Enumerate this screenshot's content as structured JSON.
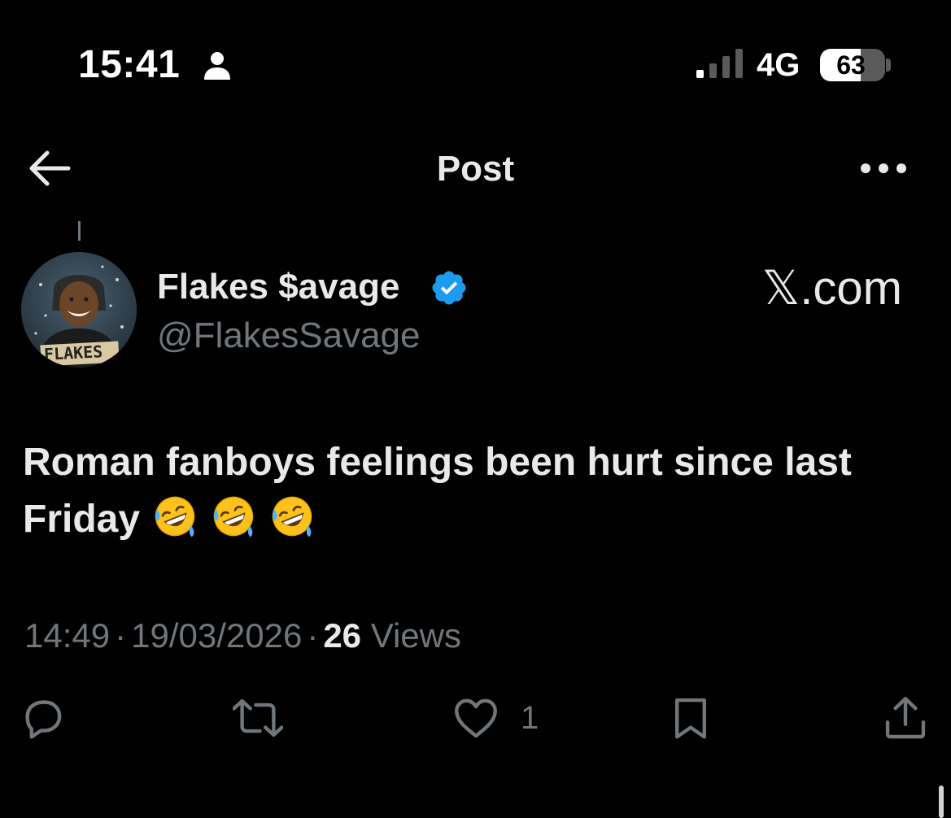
{
  "status_bar": {
    "time": "15:41",
    "network": "4G",
    "battery_percent": 63,
    "battery_label": "63",
    "icons": [
      "person-icon",
      "signal-icon",
      "battery-icon"
    ]
  },
  "header": {
    "title": "Post",
    "back_icon": "back-arrow-icon",
    "more_icon": "more-icon"
  },
  "post": {
    "author": {
      "name": "Flakes $avage",
      "handle": "@FlakesSavage",
      "verified": true,
      "avatar_text": "FLAKES"
    },
    "site_label": "𝕏.com",
    "text": "Roman fanboys feelings been hurt since last Friday",
    "emojis": [
      "🤣",
      "🤣",
      "🤣"
    ],
    "time": "14:49",
    "date": "19/03/2026",
    "views_count": "26",
    "views_label": "Views",
    "separator": "·"
  },
  "actions": {
    "reply_icon": "reply-icon",
    "repost_icon": "repost-icon",
    "like_icon": "heart-icon",
    "like_count": "1",
    "bookmark_icon": "bookmark-icon",
    "share_icon": "share-icon"
  },
  "colors": {
    "background": "#000000",
    "primary_text": "#e7e9ea",
    "secondary_text": "#71767b",
    "verified_blue": "#1d9bf0"
  }
}
